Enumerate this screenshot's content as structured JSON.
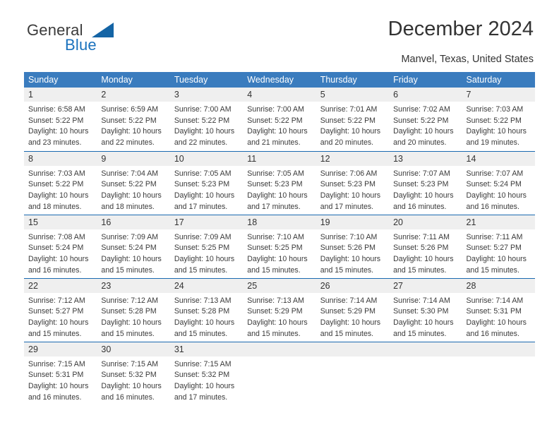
{
  "brand": {
    "name_top": "General",
    "name_bottom": "Blue",
    "triangle_icon": "brand-triangle-icon",
    "color_primary": "#1464a5",
    "color_text": "#3b3b3b"
  },
  "header": {
    "title": "December 2024",
    "subtitle": "Manvel, Texas, United States"
  },
  "colors": {
    "header_row_bg": "#3a7cbe",
    "header_row_text": "#ffffff",
    "daynum_bg": "#efefef",
    "row_divider": "#1a69b0",
    "cell_bg": "#ffffff",
    "body_text": "#3a3a3a"
  },
  "weekday_headers": [
    "Sunday",
    "Monday",
    "Tuesday",
    "Wednesday",
    "Thursday",
    "Friday",
    "Saturday"
  ],
  "labels": {
    "sunrise_prefix": "Sunrise:",
    "sunset_prefix": "Sunset:",
    "daylight_prefix": "Daylight:"
  },
  "weeks": [
    [
      {
        "day": "1",
        "sunrise": "Sunrise: 6:58 AM",
        "sunset": "Sunset: 5:22 PM",
        "daylight_line1": "Daylight: 10 hours",
        "daylight_line2": "and 23 minutes."
      },
      {
        "day": "2",
        "sunrise": "Sunrise: 6:59 AM",
        "sunset": "Sunset: 5:22 PM",
        "daylight_line1": "Daylight: 10 hours",
        "daylight_line2": "and 22 minutes."
      },
      {
        "day": "3",
        "sunrise": "Sunrise: 7:00 AM",
        "sunset": "Sunset: 5:22 PM",
        "daylight_line1": "Daylight: 10 hours",
        "daylight_line2": "and 22 minutes."
      },
      {
        "day": "4",
        "sunrise": "Sunrise: 7:00 AM",
        "sunset": "Sunset: 5:22 PM",
        "daylight_line1": "Daylight: 10 hours",
        "daylight_line2": "and 21 minutes."
      },
      {
        "day": "5",
        "sunrise": "Sunrise: 7:01 AM",
        "sunset": "Sunset: 5:22 PM",
        "daylight_line1": "Daylight: 10 hours",
        "daylight_line2": "and 20 minutes."
      },
      {
        "day": "6",
        "sunrise": "Sunrise: 7:02 AM",
        "sunset": "Sunset: 5:22 PM",
        "daylight_line1": "Daylight: 10 hours",
        "daylight_line2": "and 20 minutes."
      },
      {
        "day": "7",
        "sunrise": "Sunrise: 7:03 AM",
        "sunset": "Sunset: 5:22 PM",
        "daylight_line1": "Daylight: 10 hours",
        "daylight_line2": "and 19 minutes."
      }
    ],
    [
      {
        "day": "8",
        "sunrise": "Sunrise: 7:03 AM",
        "sunset": "Sunset: 5:22 PM",
        "daylight_line1": "Daylight: 10 hours",
        "daylight_line2": "and 18 minutes."
      },
      {
        "day": "9",
        "sunrise": "Sunrise: 7:04 AM",
        "sunset": "Sunset: 5:22 PM",
        "daylight_line1": "Daylight: 10 hours",
        "daylight_line2": "and 18 minutes."
      },
      {
        "day": "10",
        "sunrise": "Sunrise: 7:05 AM",
        "sunset": "Sunset: 5:23 PM",
        "daylight_line1": "Daylight: 10 hours",
        "daylight_line2": "and 17 minutes."
      },
      {
        "day": "11",
        "sunrise": "Sunrise: 7:05 AM",
        "sunset": "Sunset: 5:23 PM",
        "daylight_line1": "Daylight: 10 hours",
        "daylight_line2": "and 17 minutes."
      },
      {
        "day": "12",
        "sunrise": "Sunrise: 7:06 AM",
        "sunset": "Sunset: 5:23 PM",
        "daylight_line1": "Daylight: 10 hours",
        "daylight_line2": "and 17 minutes."
      },
      {
        "day": "13",
        "sunrise": "Sunrise: 7:07 AM",
        "sunset": "Sunset: 5:23 PM",
        "daylight_line1": "Daylight: 10 hours",
        "daylight_line2": "and 16 minutes."
      },
      {
        "day": "14",
        "sunrise": "Sunrise: 7:07 AM",
        "sunset": "Sunset: 5:24 PM",
        "daylight_line1": "Daylight: 10 hours",
        "daylight_line2": "and 16 minutes."
      }
    ],
    [
      {
        "day": "15",
        "sunrise": "Sunrise: 7:08 AM",
        "sunset": "Sunset: 5:24 PM",
        "daylight_line1": "Daylight: 10 hours",
        "daylight_line2": "and 16 minutes."
      },
      {
        "day": "16",
        "sunrise": "Sunrise: 7:09 AM",
        "sunset": "Sunset: 5:24 PM",
        "daylight_line1": "Daylight: 10 hours",
        "daylight_line2": "and 15 minutes."
      },
      {
        "day": "17",
        "sunrise": "Sunrise: 7:09 AM",
        "sunset": "Sunset: 5:25 PM",
        "daylight_line1": "Daylight: 10 hours",
        "daylight_line2": "and 15 minutes."
      },
      {
        "day": "18",
        "sunrise": "Sunrise: 7:10 AM",
        "sunset": "Sunset: 5:25 PM",
        "daylight_line1": "Daylight: 10 hours",
        "daylight_line2": "and 15 minutes."
      },
      {
        "day": "19",
        "sunrise": "Sunrise: 7:10 AM",
        "sunset": "Sunset: 5:26 PM",
        "daylight_line1": "Daylight: 10 hours",
        "daylight_line2": "and 15 minutes."
      },
      {
        "day": "20",
        "sunrise": "Sunrise: 7:11 AM",
        "sunset": "Sunset: 5:26 PM",
        "daylight_line1": "Daylight: 10 hours",
        "daylight_line2": "and 15 minutes."
      },
      {
        "day": "21",
        "sunrise": "Sunrise: 7:11 AM",
        "sunset": "Sunset: 5:27 PM",
        "daylight_line1": "Daylight: 10 hours",
        "daylight_line2": "and 15 minutes."
      }
    ],
    [
      {
        "day": "22",
        "sunrise": "Sunrise: 7:12 AM",
        "sunset": "Sunset: 5:27 PM",
        "daylight_line1": "Daylight: 10 hours",
        "daylight_line2": "and 15 minutes."
      },
      {
        "day": "23",
        "sunrise": "Sunrise: 7:12 AM",
        "sunset": "Sunset: 5:28 PM",
        "daylight_line1": "Daylight: 10 hours",
        "daylight_line2": "and 15 minutes."
      },
      {
        "day": "24",
        "sunrise": "Sunrise: 7:13 AM",
        "sunset": "Sunset: 5:28 PM",
        "daylight_line1": "Daylight: 10 hours",
        "daylight_line2": "and 15 minutes."
      },
      {
        "day": "25",
        "sunrise": "Sunrise: 7:13 AM",
        "sunset": "Sunset: 5:29 PM",
        "daylight_line1": "Daylight: 10 hours",
        "daylight_line2": "and 15 minutes."
      },
      {
        "day": "26",
        "sunrise": "Sunrise: 7:14 AM",
        "sunset": "Sunset: 5:29 PM",
        "daylight_line1": "Daylight: 10 hours",
        "daylight_line2": "and 15 minutes."
      },
      {
        "day": "27",
        "sunrise": "Sunrise: 7:14 AM",
        "sunset": "Sunset: 5:30 PM",
        "daylight_line1": "Daylight: 10 hours",
        "daylight_line2": "and 15 minutes."
      },
      {
        "day": "28",
        "sunrise": "Sunrise: 7:14 AM",
        "sunset": "Sunset: 5:31 PM",
        "daylight_line1": "Daylight: 10 hours",
        "daylight_line2": "and 16 minutes."
      }
    ],
    [
      {
        "day": "29",
        "sunrise": "Sunrise: 7:15 AM",
        "sunset": "Sunset: 5:31 PM",
        "daylight_line1": "Daylight: 10 hours",
        "daylight_line2": "and 16 minutes."
      },
      {
        "day": "30",
        "sunrise": "Sunrise: 7:15 AM",
        "sunset": "Sunset: 5:32 PM",
        "daylight_line1": "Daylight: 10 hours",
        "daylight_line2": "and 16 minutes."
      },
      {
        "day": "31",
        "sunrise": "Sunrise: 7:15 AM",
        "sunset": "Sunset: 5:32 PM",
        "daylight_line1": "Daylight: 10 hours",
        "daylight_line2": "and 17 minutes."
      },
      {
        "day": "",
        "sunrise": "",
        "sunset": "",
        "daylight_line1": "",
        "daylight_line2": "",
        "blank": true
      },
      {
        "day": "",
        "sunrise": "",
        "sunset": "",
        "daylight_line1": "",
        "daylight_line2": "",
        "blank": true
      },
      {
        "day": "",
        "sunrise": "",
        "sunset": "",
        "daylight_line1": "",
        "daylight_line2": "",
        "blank": true
      },
      {
        "day": "",
        "sunrise": "",
        "sunset": "",
        "daylight_line1": "",
        "daylight_line2": "",
        "blank": true
      }
    ]
  ]
}
